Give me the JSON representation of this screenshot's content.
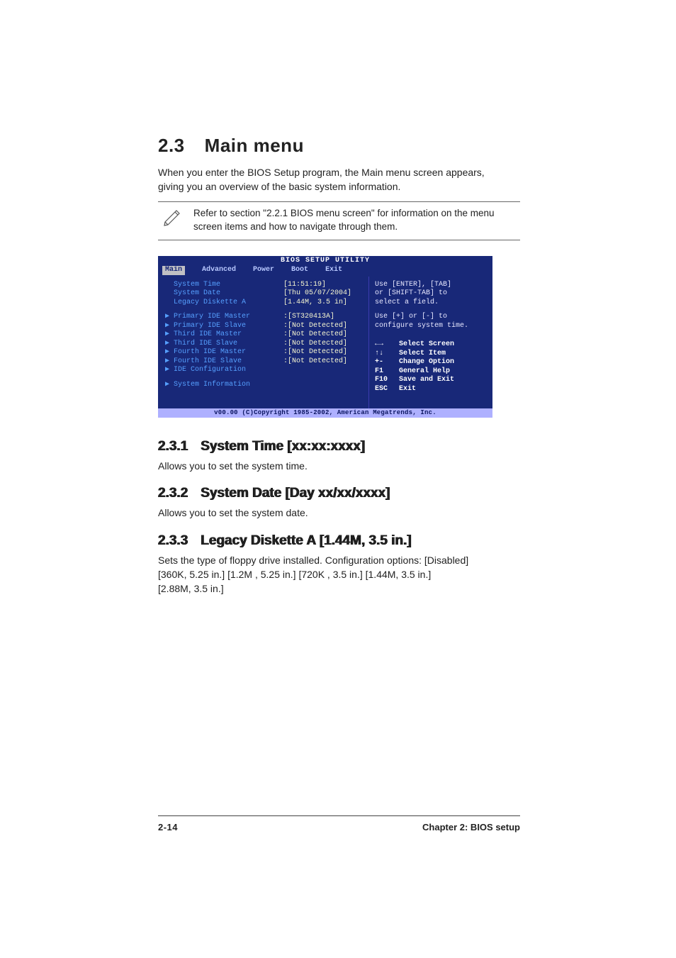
{
  "header": {
    "section_number": "2.3",
    "section_title": "Main menu",
    "intro_line1": "When you enter the BIOS Setup program, the Main menu screen appears,",
    "intro_line2": "giving you an overview of the basic system information.",
    "note_text": "Refer to section \"2.2.1  BIOS menu screen\" for information on the menu screen items and how to navigate through them."
  },
  "bios": {
    "title": "BIOS SETUP UTILITY",
    "tabs": {
      "main": "Main",
      "advanced": "Advanced",
      "power": "Power",
      "boot": "Boot",
      "exit": "Exit"
    },
    "rows_top": [
      {
        "k": "System Time",
        "v": "[11:51:19]"
      },
      {
        "k": "System Date",
        "v": "[Thu 05/07/2004]"
      },
      {
        "k": "Legacy Diskette A",
        "v": "[1.44M, 3.5 in]"
      }
    ],
    "rows_mid": [
      {
        "k": "Primary IDE Master",
        "v": ":[ST320413A]"
      },
      {
        "k": "Primary IDE Slave",
        "v": ":[Not Detected]"
      },
      {
        "k": "Third IDE Master",
        "v": ":[Not Detected]"
      },
      {
        "k": "Third IDE Slave",
        "v": ":[Not Detected]"
      },
      {
        "k": "Fourth IDE Master",
        "v": ":[Not Detected]"
      },
      {
        "k": "Fourth IDE Slave",
        "v": ":[Not Detected]"
      },
      {
        "k": "IDE Configuration",
        "v": ""
      }
    ],
    "rows_bot": [
      {
        "k": "System Information",
        "v": ""
      }
    ],
    "help_hint1a": "Use [ENTER], [TAB]",
    "help_hint1b": "or [SHIFT-TAB] to",
    "help_hint1c": "select a field.",
    "help_hint2a": "Use [+] or [-] to",
    "help_hint2b": "configure system time.",
    "keys": [
      {
        "kh": "←→",
        "kv": "Select Screen"
      },
      {
        "kh": "↑↓",
        "kv": "Select Item"
      },
      {
        "kh": "+-",
        "kv": "Change Option"
      },
      {
        "kh": "F1",
        "kv": "General Help"
      },
      {
        "kh": "F10",
        "kv": "Save and Exit"
      },
      {
        "kh": "ESC",
        "kv": "Exit"
      }
    ],
    "footer": "v00.00 (C)Copyright 1985-2002, American Megatrends, Inc."
  },
  "sub1": {
    "num": "2.3.1",
    "title": "System Time [xx:xx:xxxx]",
    "body": "Allows you to set the system time."
  },
  "sub2": {
    "num": "2.3.2",
    "title": "System Date [Day xx/xx/xxxx]",
    "body": "Allows you to set the system date."
  },
  "sub3": {
    "num": "2.3.3",
    "title": "Legacy Diskette A [1.44M, 3.5 in.]",
    "body1": "Sets the type of floppy drive installed. Configuration options: [Disabled]",
    "body2": "[360K, 5.25 in.] [1.2M , 5.25 in.] [720K , 3.5 in.] [1.44M, 3.5 in.]",
    "body3": "[2.88M, 3.5  in.]"
  },
  "footer": {
    "left": "2-14",
    "right": "Chapter 2: BIOS setup"
  }
}
